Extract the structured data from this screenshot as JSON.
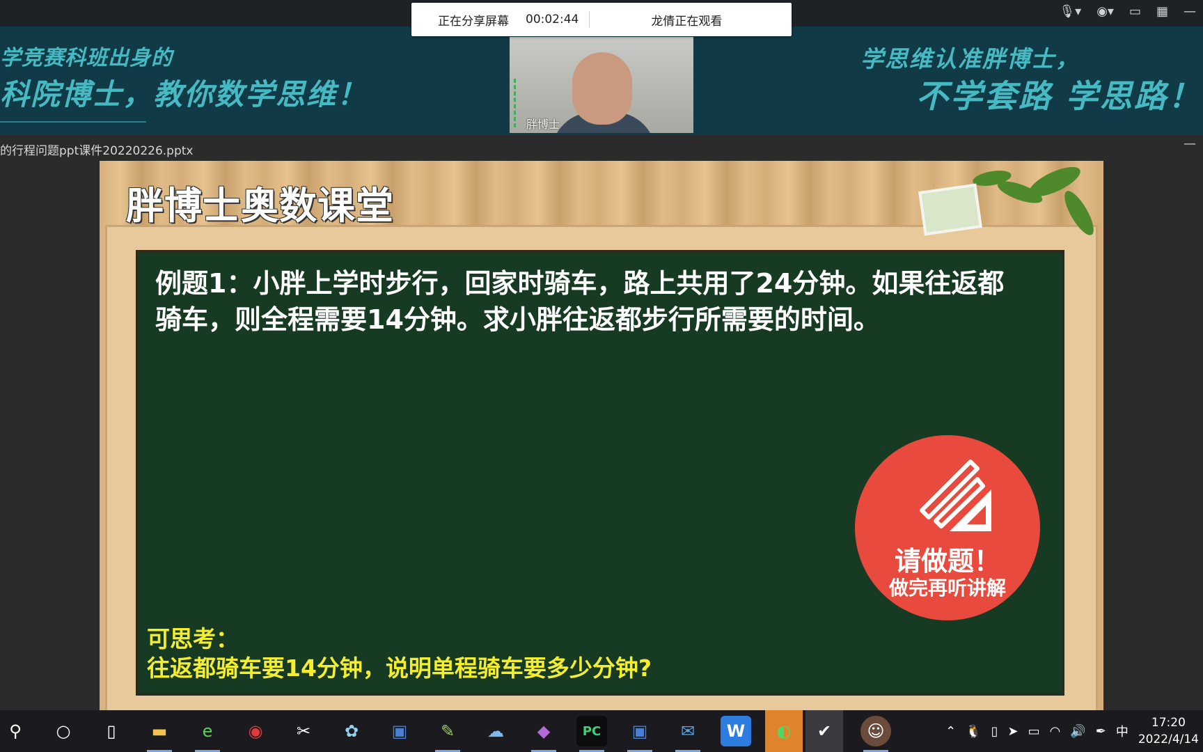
{
  "meeting": {
    "share_status": "正在分享屏幕",
    "elapsed": "00:02:44",
    "viewer": "龙倩正在观看",
    "participant_name": "胖博士"
  },
  "banner": {
    "left_line1": "学竞赛科班出身的",
    "left_line2": "科院博士，教你数学思维！",
    "right_line1": "学思维认准胖博士，",
    "right_line2": "不学套路 学思路！"
  },
  "document": {
    "title": "的行程问题ppt课件20220226.pptx",
    "minimize": "—"
  },
  "slide": {
    "brand_title": "胖博士奥数课堂",
    "question_line1": "例题1：小胖上学时步行，回家时骑车，路上共用了24分钟。如果往返都",
    "question_line2": "骑车，则全程需要14分钟。求小胖往返都步行所需要的时间。",
    "hint_label": "可思考：",
    "hint_text": "往返都骑车要14分钟，说明单程骑车要多少分钟?",
    "badge_title": "请做题！",
    "badge_subtitle": "做完再听讲解"
  },
  "taskbar": {
    "items": [
      {
        "name": "search-icon",
        "glyph": "⚲"
      },
      {
        "name": "cortana-icon",
        "glyph": "○"
      },
      {
        "name": "task-view-icon",
        "glyph": "▯"
      },
      {
        "name": "file-explorer-icon",
        "glyph": "▬"
      },
      {
        "name": "browser-icon",
        "glyph": "e"
      },
      {
        "name": "red-app-icon",
        "glyph": "◉"
      },
      {
        "name": "video-editor-icon",
        "glyph": "✂"
      },
      {
        "name": "flower-app-icon",
        "glyph": "✿"
      },
      {
        "name": "save-app-icon",
        "glyph": "▣"
      },
      {
        "name": "notepad-icon",
        "glyph": "✎"
      },
      {
        "name": "cloud-app-icon",
        "glyph": "☁"
      },
      {
        "name": "meeting-app-icon",
        "glyph": "◆"
      },
      {
        "name": "pycharm-icon",
        "glyph": "PC"
      },
      {
        "name": "save-app-2-icon",
        "glyph": "▣"
      },
      {
        "name": "mail-icon",
        "glyph": "✉"
      },
      {
        "name": "wps-icon",
        "glyph": "W"
      },
      {
        "name": "wechat-icon",
        "glyph": "◐"
      },
      {
        "name": "active-app-icon",
        "glyph": "✔"
      },
      {
        "name": "avatar-icon",
        "glyph": "☺"
      }
    ],
    "ime": "中",
    "time": "17:20",
    "date": "2022/4/14"
  },
  "colors": {
    "banner_bg": "#103a45",
    "banner_text": "#47b9c2",
    "board": "#173a22",
    "hint": "#f4ee2e",
    "badge": "#e84a3d"
  }
}
